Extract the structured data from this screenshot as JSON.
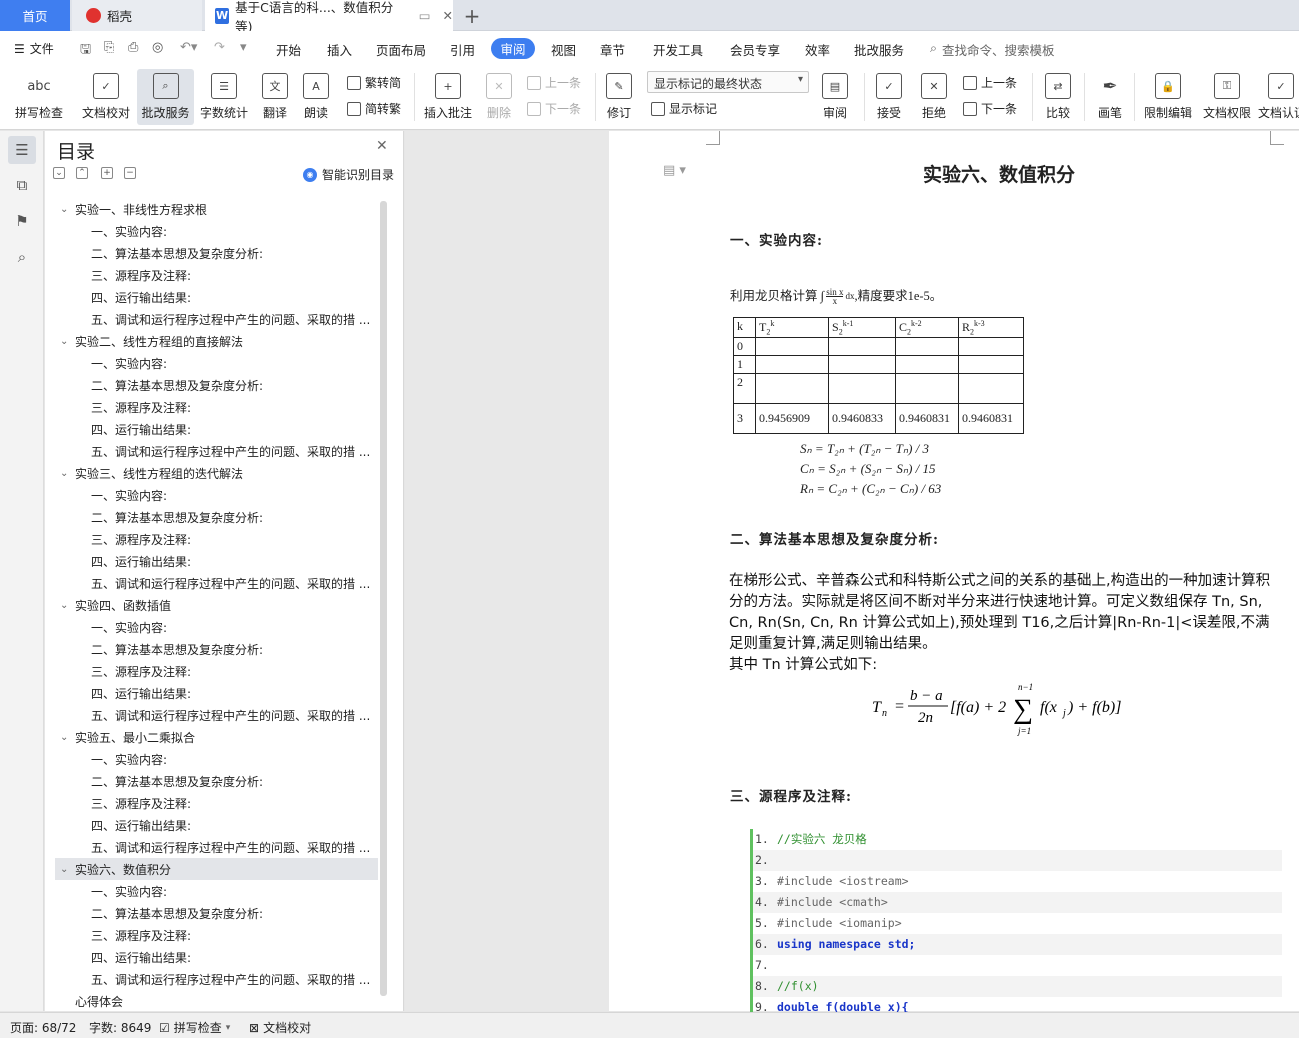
{
  "tabs": {
    "home": "首页",
    "daoke": "稻壳",
    "doc": "基于C语言的科...、数值积分等)",
    "doc_icon": "W",
    "plus": "+"
  },
  "menu": {
    "file": "文件",
    "items": [
      "开始",
      "插入",
      "页面布局",
      "引用",
      "审阅",
      "视图",
      "章节",
      "开发工具",
      "会员专享",
      "效率",
      "批改服务"
    ],
    "active": "审阅",
    "search": "查找命令、搜索模板"
  },
  "ribbon": {
    "spell": "拼写检查",
    "spell_icon": "abc",
    "proof": "文档校对",
    "grading": "批改服务",
    "wordcount": "字数统计",
    "translate": "翻译",
    "read": "朗读",
    "trad": "繁转简",
    "simp": "简转繁",
    "insert_comment": "插入批注",
    "delete": "删除",
    "prev_comment": "上一条",
    "next_comment": "下一条",
    "revise": "修订",
    "markup_select": "显示标记的最终状态",
    "show_markup": "显示标记",
    "review": "审阅",
    "accept": "接受",
    "reject": "拒绝",
    "prev": "上一条",
    "next": "下一条",
    "compare": "比较",
    "pen": "画笔",
    "restrict": "限制编辑",
    "doc_perm": "文档权限",
    "doc_cert": "文档认证"
  },
  "toc": {
    "title": "目录",
    "smart": "智能识别目录",
    "items": [
      {
        "label": "实验一、非线性方程求根",
        "level": 1
      },
      {
        "label": "一、实验内容:",
        "level": 2
      },
      {
        "label": "二、算法基本思想及复杂度分析:",
        "level": 2
      },
      {
        "label": "三、源程序及注释:",
        "level": 2
      },
      {
        "label": "四、运行输出结果:",
        "level": 2
      },
      {
        "label": "五、调试和运行程序过程中产生的问题、采取的措 ...",
        "level": 2
      },
      {
        "label": "实验二、线性方程组的直接解法",
        "level": 1
      },
      {
        "label": "一、实验内容:",
        "level": 2
      },
      {
        "label": "二、算法基本思想及复杂度分析:",
        "level": 2
      },
      {
        "label": "三、源程序及注释:",
        "level": 2
      },
      {
        "label": "四、运行输出结果:",
        "level": 2
      },
      {
        "label": "五、调试和运行程序过程中产生的问题、采取的措 ...",
        "level": 2
      },
      {
        "label": "实验三、线性方程组的迭代解法",
        "level": 1
      },
      {
        "label": "一、实验内容:",
        "level": 2
      },
      {
        "label": "二、算法基本思想及复杂度分析:",
        "level": 2
      },
      {
        "label": "三、源程序及注释:",
        "level": 2
      },
      {
        "label": "四、运行输出结果:",
        "level": 2
      },
      {
        "label": "五、调试和运行程序过程中产生的问题、采取的措 ...",
        "level": 2
      },
      {
        "label": "实验四、函数插值",
        "level": 1
      },
      {
        "label": "一、实验内容:",
        "level": 2
      },
      {
        "label": "二、算法基本思想及复杂度分析:",
        "level": 2
      },
      {
        "label": "三、源程序及注释:",
        "level": 2
      },
      {
        "label": "四、运行输出结果:",
        "level": 2
      },
      {
        "label": "五、调试和运行程序过程中产生的问题、采取的措 ...",
        "level": 2
      },
      {
        "label": "实验五、最小二乘拟合",
        "level": 1
      },
      {
        "label": "一、实验内容:",
        "level": 2
      },
      {
        "label": "二、算法基本思想及复杂度分析:",
        "level": 2
      },
      {
        "label": "三、源程序及注释:",
        "level": 2
      },
      {
        "label": "四、运行输出结果:",
        "level": 2
      },
      {
        "label": "五、调试和运行程序过程中产生的问题、采取的措 ...",
        "level": 2
      },
      {
        "label": "实验六、数值积分",
        "level": 1,
        "selected": true
      },
      {
        "label": "一、实验内容:",
        "level": 2
      },
      {
        "label": "二、算法基本思想及复杂度分析:",
        "level": 2
      },
      {
        "label": "三、源程序及注释:",
        "level": 2
      },
      {
        "label": "四、运行输出结果:",
        "level": 2
      },
      {
        "label": "五、调试和运行程序过程中产生的问题、采取的措 ...",
        "level": 2
      },
      {
        "label": "心得体会",
        "level": 0
      }
    ]
  },
  "doc": {
    "title": "实验六、数值积分",
    "h_content": "一、实验内容:",
    "task_prefix": "利用龙贝格计算",
    "task_suffix": ",精度要求1e-5。",
    "table": {
      "headers": [
        "k",
        "T",
        "S",
        "C",
        "R"
      ],
      "header_sub": [
        "",
        "2",
        "2",
        "2",
        "2"
      ],
      "header_sup": [
        "",
        "k",
        "k-1",
        "k-2",
        "k-3"
      ],
      "rows": [
        [
          "0",
          "",
          "",
          "",
          ""
        ],
        [
          "1",
          "",
          "",
          "",
          ""
        ],
        [
          "2",
          "",
          "",
          "",
          ""
        ],
        [
          "3",
          "0.9456909",
          "0.9460833",
          "0.9460831",
          "0.9460831"
        ]
      ]
    },
    "formulas": [
      "Sₙ = T₂ₙ + (T₂ₙ − Tₙ) / 3",
      "Cₙ = S₂ₙ + (S₂ₙ − Sₙ) / 15",
      "Rₙ = C₂ₙ + (C₂ₙ − Cₙ) / 63"
    ],
    "h_algo": "二、算法基本思想及复杂度分析:",
    "algo_text": "在梯形公式、辛普森公式和科特斯公式之间的关系的基础上,构造出的一种加速计算积分的方法。实际就是将区间不断对半分来进行快速地计算。可定义数组保存 Tn, Sn, Cn, Rn(Sn, Cn, Rn 计算公式如上),预处理到 T16,之后计算|Rn-Rn-1|<误差限,不满足则重复计算,满足则输出结果。",
    "algo_text2": "其中 Tn 计算公式如下:",
    "h_code": "三、源程序及注释:",
    "code": [
      {
        "n": "1.",
        "t": "//实验六 龙贝格",
        "cls": "cm"
      },
      {
        "n": "2.",
        "t": "",
        "cls": ""
      },
      {
        "n": "3.",
        "t": "#include <iostream>",
        "cls": "pp"
      },
      {
        "n": "4.",
        "t": "#include <cmath>",
        "cls": "pp"
      },
      {
        "n": "5.",
        "t": "#include <iomanip>",
        "cls": "pp"
      },
      {
        "n": "6.",
        "t": "using namespace std;",
        "cls": "kw"
      },
      {
        "n": "7.",
        "t": "",
        "cls": ""
      },
      {
        "n": "8.",
        "t": "//f(x)",
        "cls": "cm"
      },
      {
        "n": "9.",
        "t": "double f(double x){",
        "cls": "kw"
      }
    ]
  },
  "status": {
    "page": "页面: 68/72",
    "words": "字数: 8649",
    "spell": "拼写检查",
    "proof": "文档校对"
  }
}
